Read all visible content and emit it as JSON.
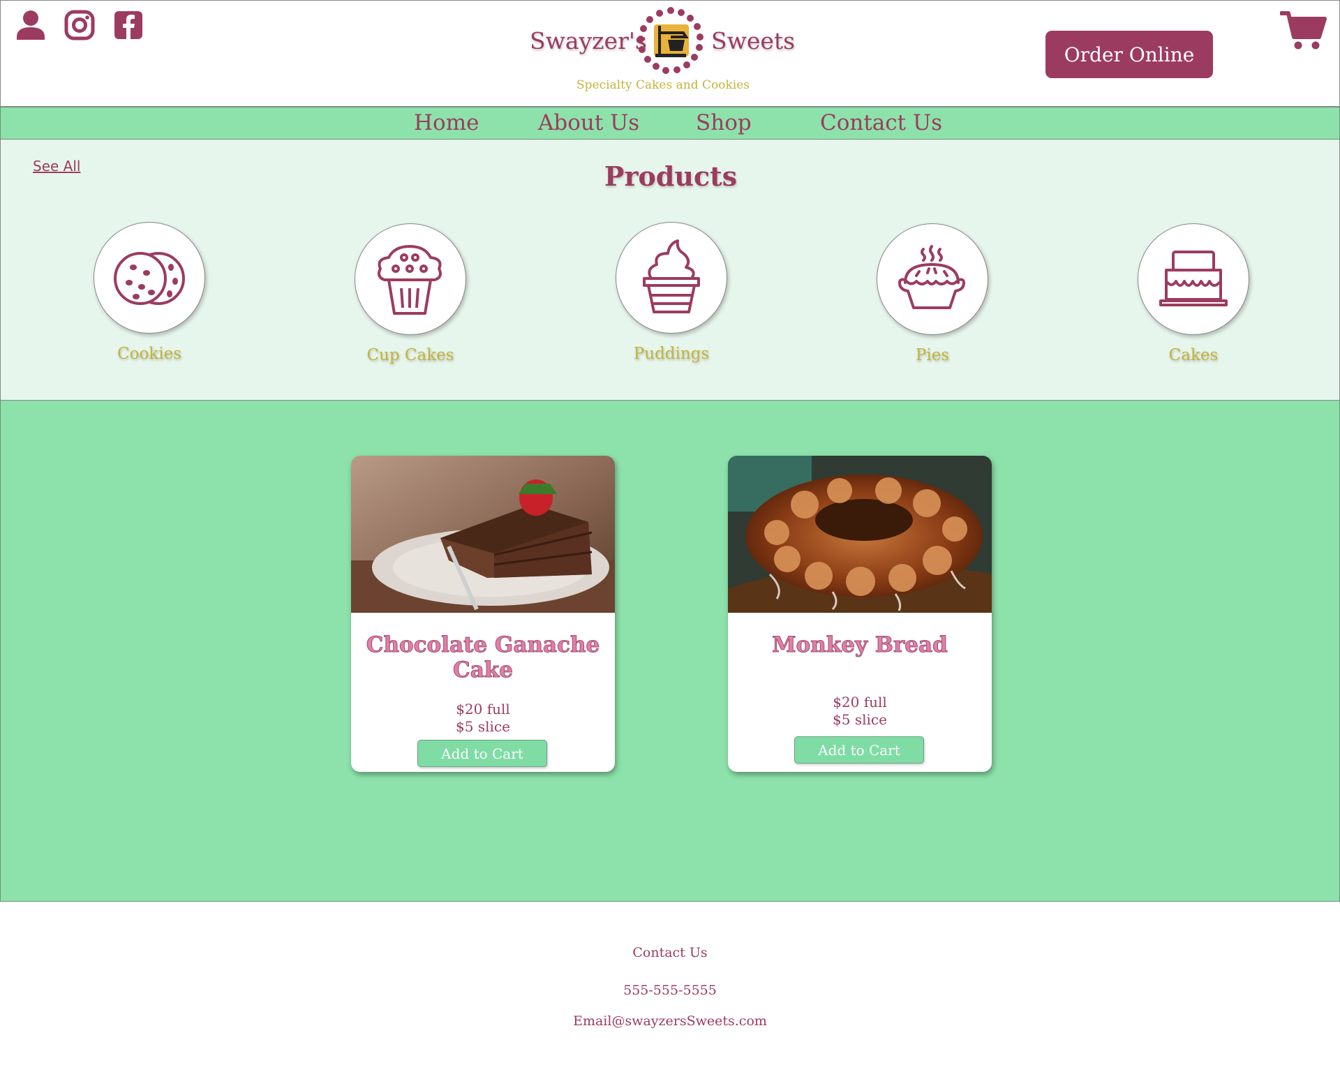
{
  "header": {
    "brand_left": "Swayzer's",
    "brand_right": "Sweets",
    "tagline": "Specialty Cakes and Cookies",
    "order_button": "Order Online",
    "social_icons": [
      "user-icon",
      "instagram-icon",
      "facebook-icon"
    ],
    "cart_icon": "cart-icon"
  },
  "nav": {
    "items": [
      {
        "label": "Home"
      },
      {
        "label": "About Us"
      },
      {
        "label": "Shop"
      },
      {
        "label": "Contact Us"
      }
    ]
  },
  "products": {
    "see_all": "See All",
    "title": "Products",
    "categories": [
      {
        "label": "Cookies",
        "icon": "cookies-icon"
      },
      {
        "label": "Cup Cakes",
        "icon": "cupcake-icon"
      },
      {
        "label": "Puddings",
        "icon": "pudding-icon"
      },
      {
        "label": "Pies",
        "icon": "pie-icon"
      },
      {
        "label": "Cakes",
        "icon": "cake-icon"
      }
    ]
  },
  "featured": {
    "items": [
      {
        "name": "Chocolate Ganache Cake",
        "price_full": "$20 full",
        "price_slice": "$5 slice",
        "button": "Add to Cart",
        "image": "chocolate-cake-photo"
      },
      {
        "name": "Monkey Bread",
        "price_full": "$20 full",
        "price_slice": "$5 slice",
        "button": "Add to Cart",
        "image": "monkey-bread-photo"
      }
    ]
  },
  "footer": {
    "contact": "Contact Us",
    "phone": "555-555-5555",
    "email": "Email@swayzersSweets.com"
  },
  "colors": {
    "brand": "#9c3b60",
    "mint": "#8ce2aa",
    "mint_light": "#e7f6ec",
    "gold": "#c4b43a",
    "pink_title": "#e07fa7"
  }
}
